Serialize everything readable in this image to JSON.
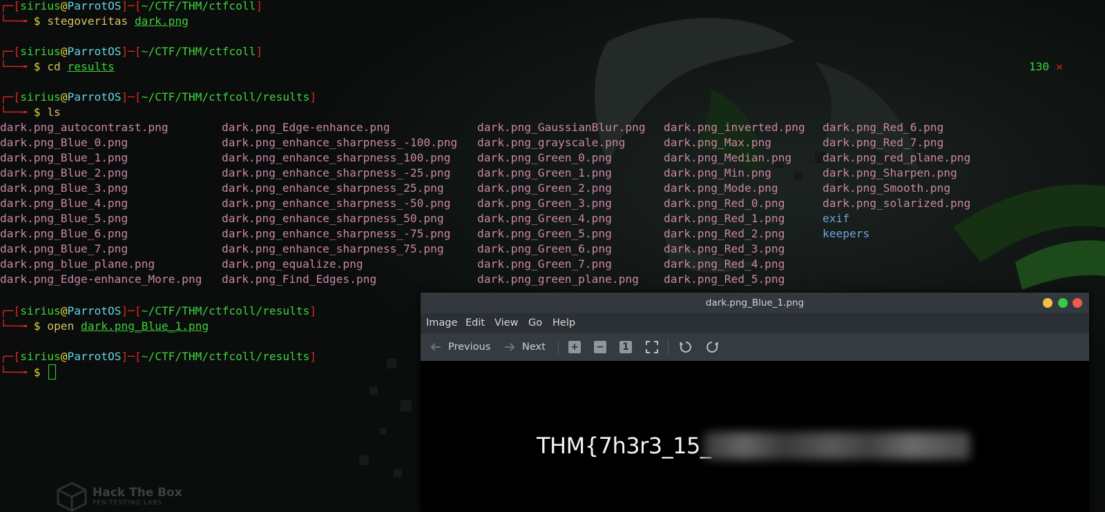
{
  "terminal": {
    "prompt": {
      "user": "sirius",
      "at": "@",
      "host": "ParrotOS",
      "dash": "─",
      "corner": "└──╼",
      "dollar": "$"
    },
    "blocks": [
      {
        "path": "~/CTF/THM/ctfcoll",
        "command": "stegoveritas",
        "argument": "dark.png"
      },
      {
        "path": "~/CTF/THM/ctfcoll",
        "command": "cd",
        "argument": "results"
      },
      {
        "path": "~/CTF/THM/ctfcoll/results",
        "command": "ls",
        "argument": ""
      },
      {
        "path": "~/CTF/THM/ctfcoll/results",
        "command": "open",
        "argument": "dark.png_Blue_1.png"
      },
      {
        "path": "~/CTF/THM/ctfcoll/results",
        "command": "",
        "argument": ""
      }
    ],
    "exit_status": "130",
    "exit_mark": "✕",
    "ls_columns": [
      [
        "dark.png_autocontrast.png",
        "dark.png_Blue_0.png",
        "dark.png_Blue_1.png",
        "dark.png_Blue_2.png",
        "dark.png_Blue_3.png",
        "dark.png_Blue_4.png",
        "dark.png_Blue_5.png",
        "dark.png_Blue_6.png",
        "dark.png_Blue_7.png",
        "dark.png_blue_plane.png",
        "dark.png_Edge-enhance_More.png"
      ],
      [
        "dark.png_Edge-enhance.png",
        "dark.png_enhance_sharpness_-100.png",
        "dark.png_enhance_sharpness_100.png",
        "dark.png_enhance_sharpness_-25.png",
        "dark.png_enhance_sharpness_25.png",
        "dark.png_enhance_sharpness_-50.png",
        "dark.png_enhance_sharpness_50.png",
        "dark.png_enhance_sharpness_-75.png",
        "dark.png_enhance_sharpness_75.png",
        "dark.png_equalize.png",
        "dark.png_Find_Edges.png"
      ],
      [
        "dark.png_GaussianBlur.png",
        "dark.png_grayscale.png",
        "dark.png_Green_0.png",
        "dark.png_Green_1.png",
        "dark.png_Green_2.png",
        "dark.png_Green_3.png",
        "dark.png_Green_4.png",
        "dark.png_Green_5.png",
        "dark.png_Green_6.png",
        "dark.png_Green_7.png",
        "dark.png_green_plane.png"
      ],
      [
        "dark.png_inverted.png",
        "dark.png_Max.png",
        "dark.png_Median.png",
        "dark.png_Min.png",
        "dark.png_Mode.png",
        "dark.png_Red_0.png",
        "dark.png_Red_1.png",
        "dark.png_Red_2.png",
        "dark.png_Red_3.png",
        "dark.png_Red_4.png",
        "dark.png_Red_5.png"
      ],
      [
        "dark.png_Red_6.png",
        "dark.png_Red_7.png",
        "dark.png_red_plane.png",
        "dark.png_Sharpen.png",
        "dark.png_Smooth.png",
        "dark.png_solarized.png",
        "exif",
        "keepers"
      ]
    ],
    "directories": [
      "exif",
      "keepers"
    ]
  },
  "viewer": {
    "title": "dark.png_Blue_1.png",
    "menu": [
      "Image",
      "Edit",
      "View",
      "Go",
      "Help"
    ],
    "toolbar": {
      "previous_label": "Previous",
      "next_label": "Next",
      "zoom_in_glyph": "+",
      "zoom_out_glyph": "−",
      "actual_size_glyph": "1"
    },
    "image_text": "THM{7h3r3_15_"
  },
  "background": {
    "logo_title": "Hack The Box",
    "logo_subtitle": "PEN-TESTING LABS"
  },
  "colors": {
    "prompt_red": "#e0271d",
    "prompt_green": "#3ed23a",
    "at_yellow": "#e6d23c",
    "host_cyan": "#67d3de",
    "file_pink": "#c986a8",
    "dir_blue": "#6fa5df",
    "close_red": "#ee5a52",
    "minimize_yellow": "#f4bf45",
    "maximize_green": "#36c94a"
  },
  "icons": [
    "previous-arrow-icon",
    "next-arrow-icon",
    "zoom-in-icon",
    "zoom-out-icon",
    "actual-size-icon",
    "fullscreen-icon",
    "rotate-left-icon",
    "rotate-right-icon",
    "window-close-icon",
    "window-maximize-icon",
    "window-minimize-icon",
    "hackthebox-cube-icon"
  ]
}
